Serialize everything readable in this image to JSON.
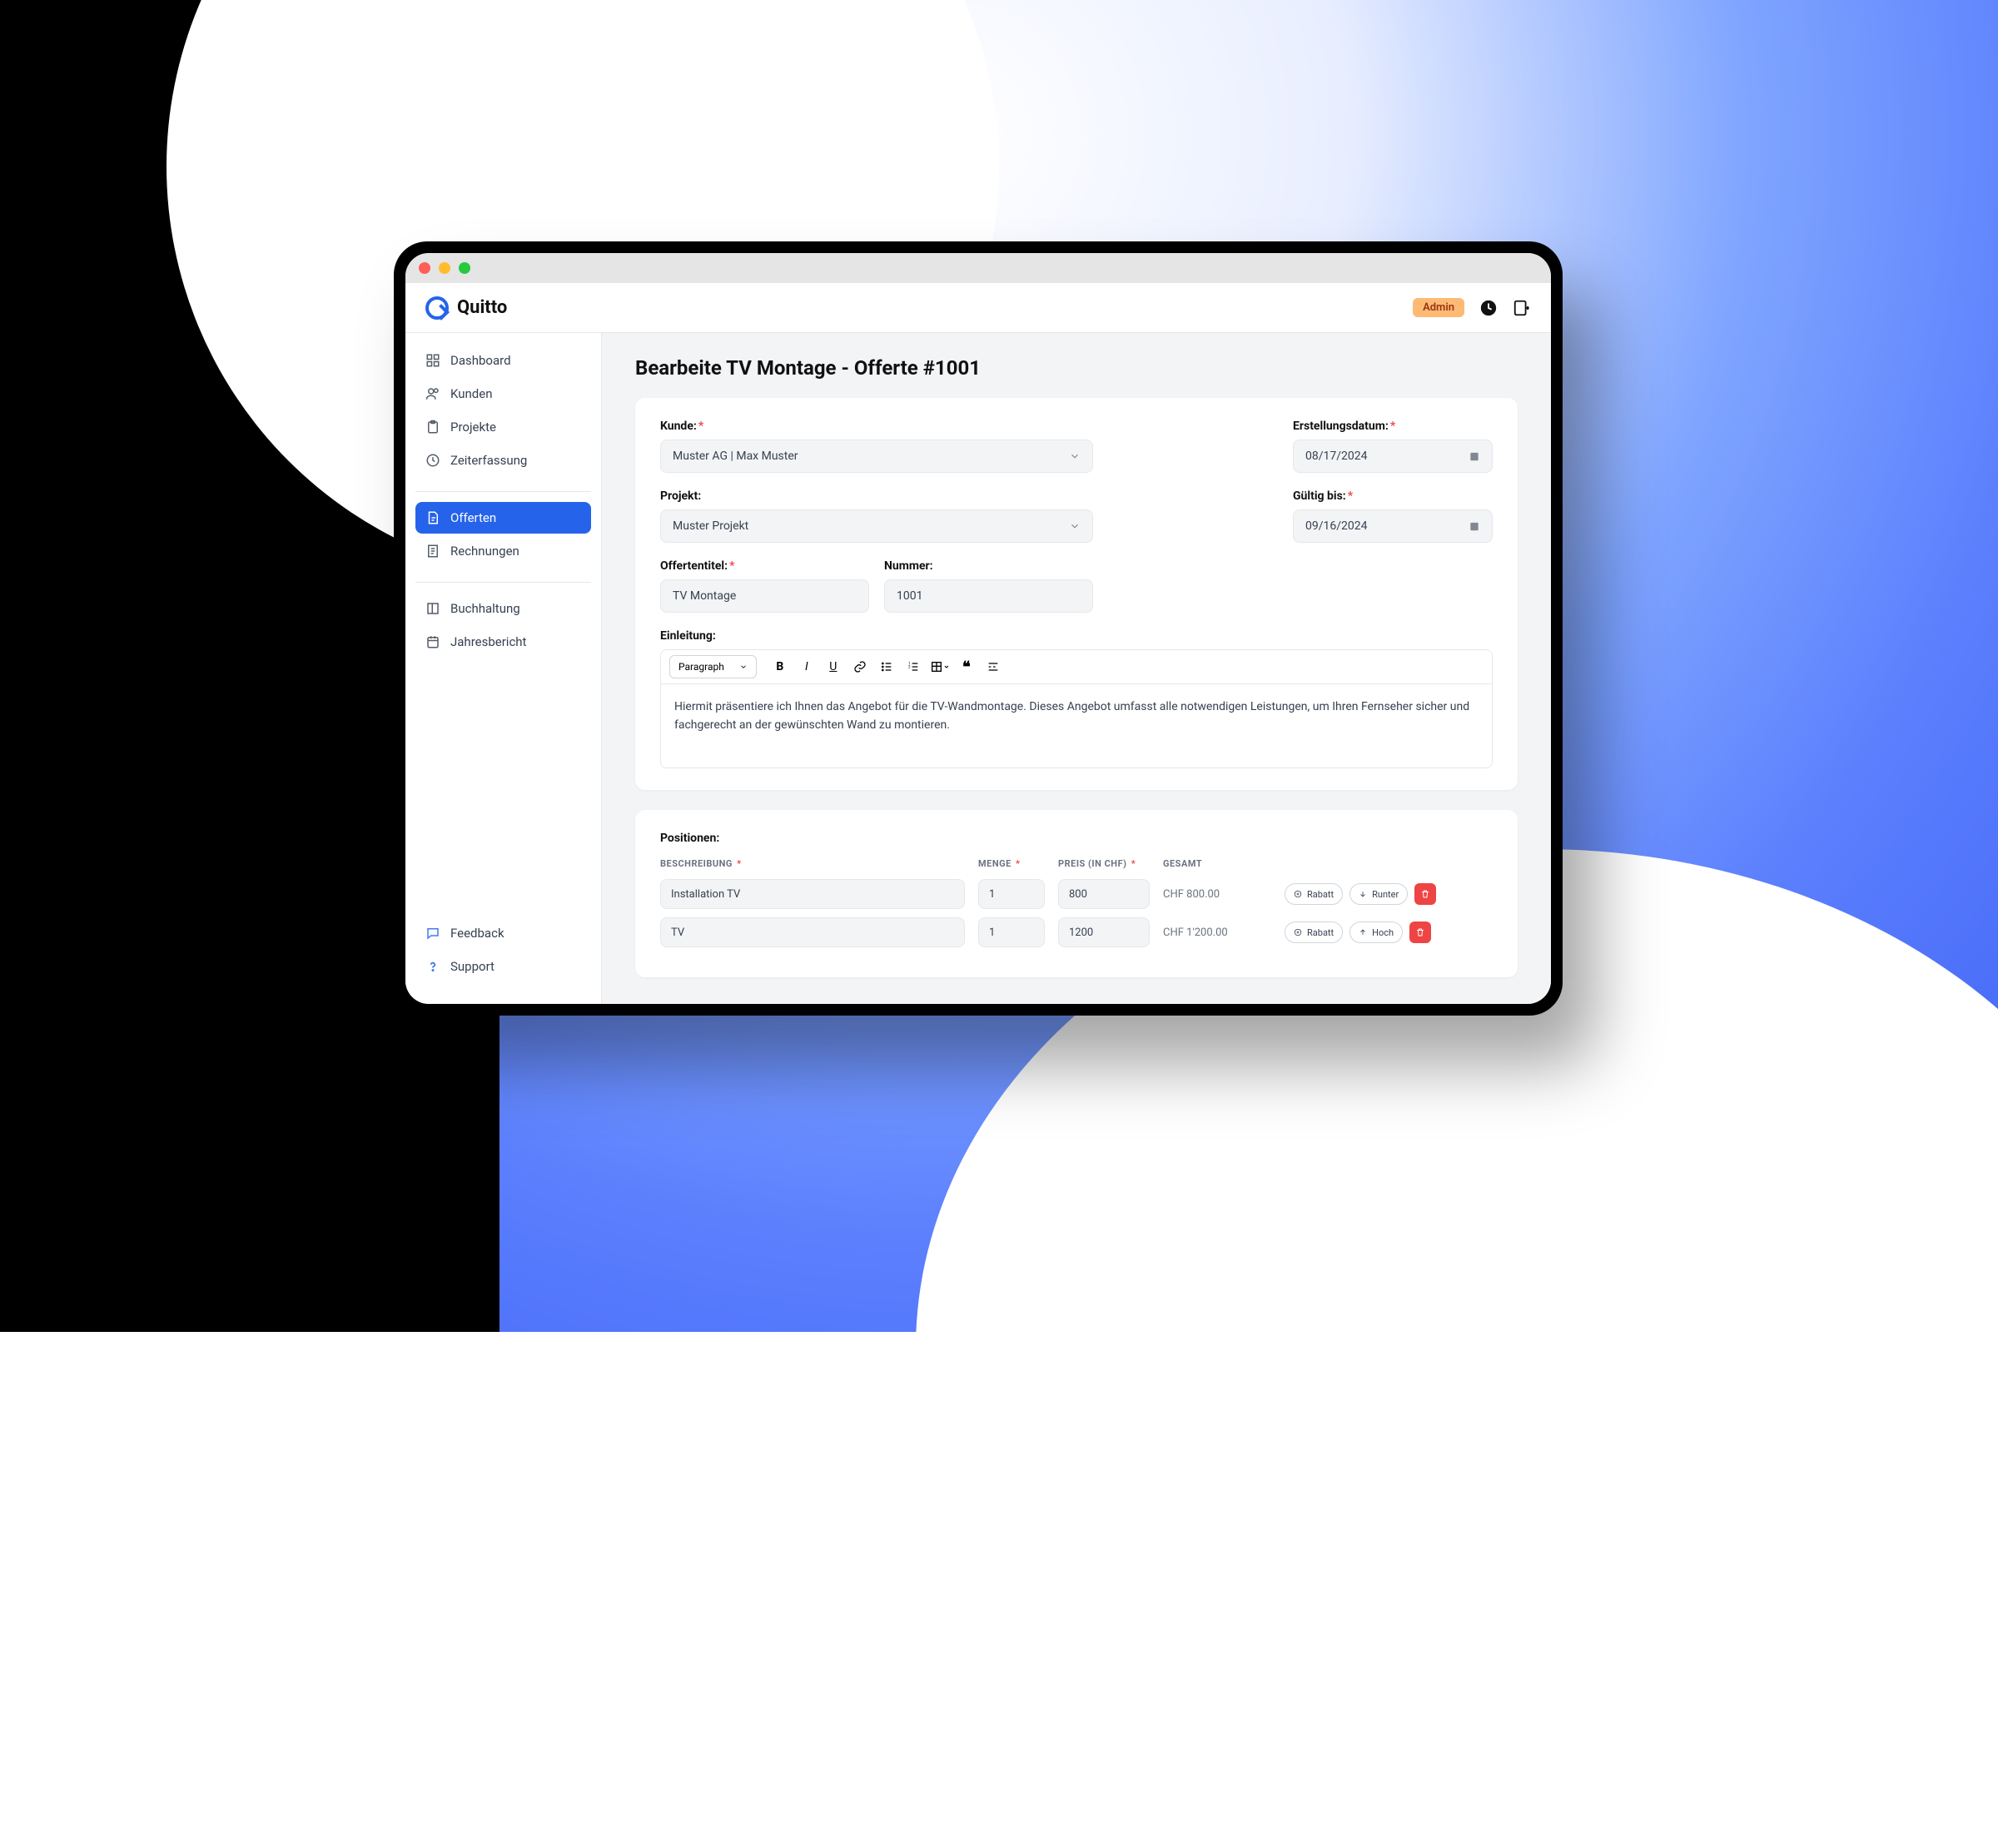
{
  "brand": {
    "name": "Quitto"
  },
  "topbar": {
    "admin_badge": "Admin"
  },
  "sidebar": {
    "groups": [
      [
        {
          "icon": "grid",
          "label": "Dashboard",
          "active": false
        },
        {
          "icon": "users",
          "label": "Kunden",
          "active": false
        },
        {
          "icon": "clipboard",
          "label": "Projekte",
          "active": false
        },
        {
          "icon": "clock",
          "label": "Zeiterfassung",
          "active": false
        }
      ],
      [
        {
          "icon": "doc-edit",
          "label": "Offerten",
          "active": true
        },
        {
          "icon": "receipt",
          "label": "Rechnungen",
          "active": false
        }
      ],
      [
        {
          "icon": "book",
          "label": "Buchhaltung",
          "active": false
        },
        {
          "icon": "calendar",
          "label": "Jahresbericht",
          "active": false
        }
      ]
    ],
    "footer": [
      {
        "icon": "chat",
        "label": "Feedback"
      },
      {
        "icon": "help",
        "label": "Support"
      }
    ]
  },
  "page": {
    "title": "Bearbeite TV Montage - Offerte #1001"
  },
  "form": {
    "kunde": {
      "label": "Kunde:",
      "value": "Muster AG | Max Muster"
    },
    "projekt": {
      "label": "Projekt:",
      "value": "Muster Projekt"
    },
    "offertentitel": {
      "label": "Offertentitel:",
      "value": "TV Montage"
    },
    "nummer": {
      "label": "Nummer:",
      "value": "1001"
    },
    "erstellungsdatum": {
      "label": "Erstellungsdatum:",
      "value": "08/17/2024"
    },
    "gueltig_bis": {
      "label": "Gültig bis:",
      "value": "09/16/2024"
    },
    "einleitung": {
      "label": "Einleitung:",
      "block_type": "Paragraph",
      "text": "Hiermit präsentiere ich Ihnen das Angebot für die TV-Wandmontage. Dieses Angebot umfasst alle notwendigen Leistungen, um Ihren Fernseher sicher und fachgerecht an der gewünschten Wand zu montieren."
    }
  },
  "positions": {
    "label": "Positionen:",
    "headers": {
      "beschreibung": "BESCHREIBUNG",
      "menge": "MENGE",
      "preis": "PREIS (IN CHF)",
      "gesamt": "GESAMT"
    },
    "actions": {
      "rabatt": "Rabatt",
      "runter": "Runter",
      "hoch": "Hoch"
    },
    "rows": [
      {
        "beschreibung": "Installation TV",
        "menge": "1",
        "preis": "800",
        "gesamt": "CHF 800.00",
        "move": "Runter"
      },
      {
        "beschreibung": "TV",
        "menge": "1",
        "preis": "1200",
        "gesamt": "CHF 1'200.00",
        "move": "Hoch"
      }
    ]
  }
}
